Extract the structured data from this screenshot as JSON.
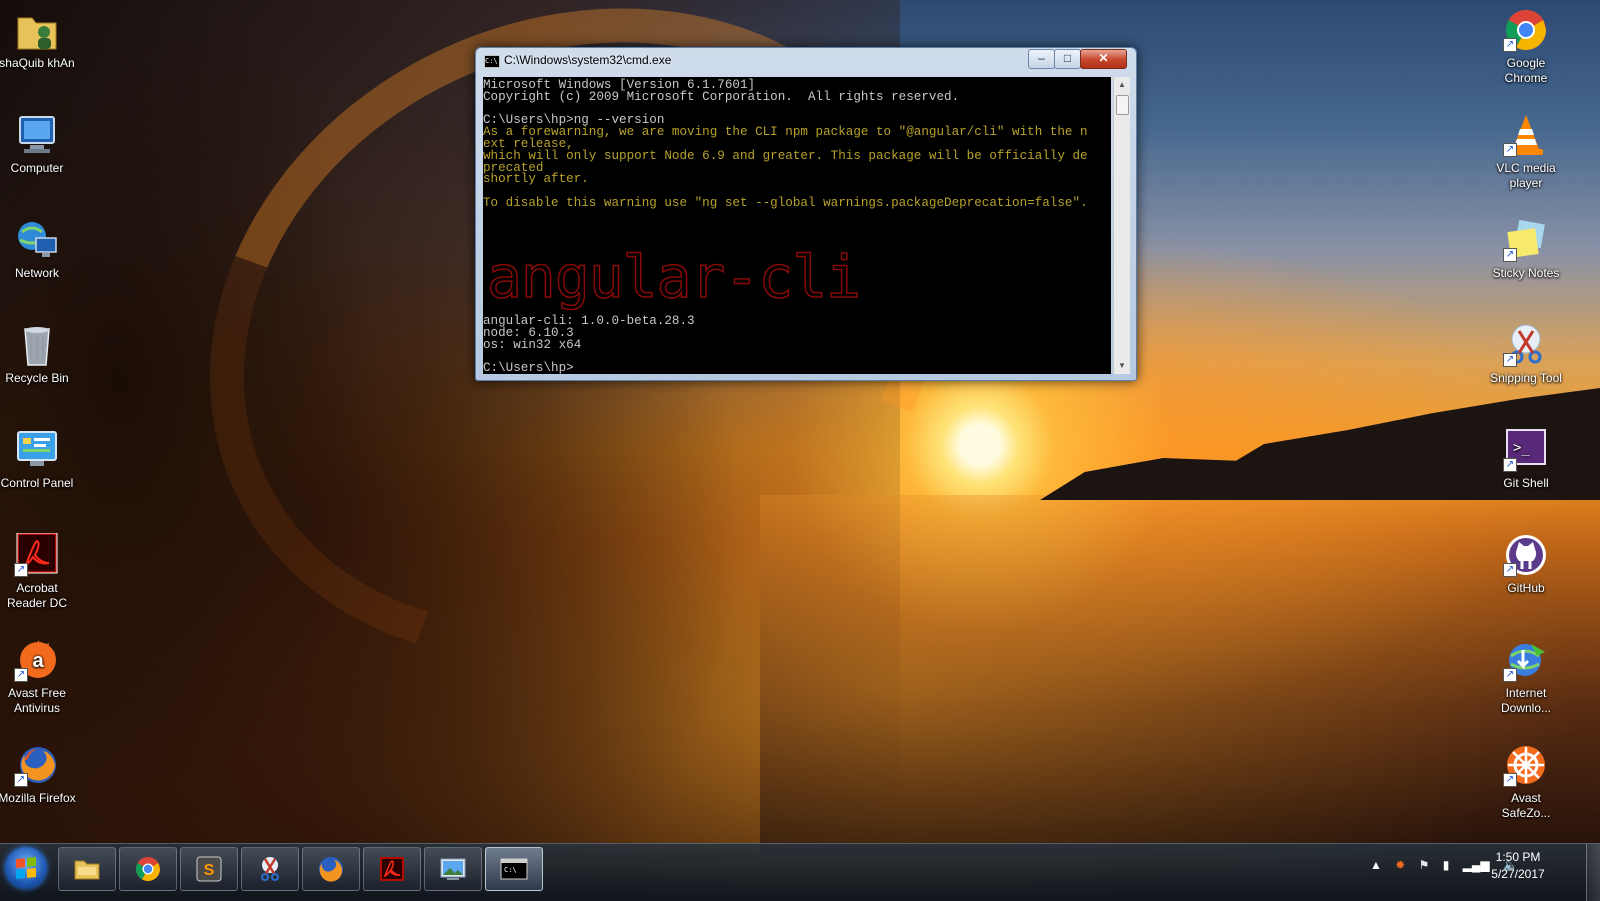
{
  "desktop": {
    "left_icons": [
      {
        "label": "shaQuib khAn",
        "icon": "user-folder-icon"
      },
      {
        "label": "Computer",
        "icon": "computer-icon"
      },
      {
        "label": "Network",
        "icon": "network-icon"
      },
      {
        "label": "Recycle Bin",
        "icon": "recycle-bin-icon"
      },
      {
        "label": "Control Panel",
        "icon": "control-panel-icon"
      },
      {
        "label": "Acrobat Reader DC",
        "icon": "acrobat-icon"
      },
      {
        "label": "Avast Free Antivirus",
        "icon": "avast-icon"
      },
      {
        "label": "Mozilla Firefox",
        "icon": "firefox-icon"
      }
    ],
    "right_icons": [
      {
        "label": "Google Chrome",
        "icon": "chrome-icon"
      },
      {
        "label": "VLC media player",
        "icon": "vlc-icon"
      },
      {
        "label": "Sticky Notes",
        "icon": "sticky-notes-icon"
      },
      {
        "label": "Snipping Tool",
        "icon": "snipping-tool-icon"
      },
      {
        "label": "Git Shell",
        "icon": "git-shell-icon"
      },
      {
        "label": "GitHub",
        "icon": "github-icon"
      },
      {
        "label": "Internet Downlo...",
        "icon": "internet-download-manager-icon"
      },
      {
        "label": "Avast SafeZo...",
        "icon": "avast-safezone-icon"
      }
    ]
  },
  "cmd": {
    "title": "C:\\Windows\\system32\\cmd.exe",
    "buttons": {
      "minimize": "–",
      "maximize": "□",
      "close": "✕"
    },
    "lines": [
      {
        "text": "Microsoft Windows [Version 6.1.7601]",
        "color": "white"
      },
      {
        "text": "Copyright (c) 2009 Microsoft Corporation.  All rights reserved.",
        "color": "white"
      },
      {
        "text": "",
        "color": "white"
      },
      {
        "text": "C:\\Users\\hp>ng --version",
        "color": "white"
      },
      {
        "text": "As a forewarning, we are moving the CLI npm package to \"@angular/cli\" with the n",
        "color": "yellow"
      },
      {
        "text": "ext release,",
        "color": "yellow"
      },
      {
        "text": "which will only support Node 6.9 and greater. This package will be officially de",
        "color": "yellow"
      },
      {
        "text": "precated",
        "color": "yellow"
      },
      {
        "text": "shortly after.",
        "color": "yellow"
      },
      {
        "text": "",
        "color": "yellow"
      },
      {
        "text": "To disable this warning use \"ng set --global warnings.packageDeprecation=false\".",
        "color": "yellow"
      }
    ],
    "ascii_banner": "angular-cli",
    "version_lines": [
      {
        "text": "angular-cli: 1.0.0-beta.28.3",
        "color": "white"
      },
      {
        "text": "node: 6.10.3",
        "color": "white"
      },
      {
        "text": "os: win32 x64",
        "color": "white"
      },
      {
        "text": "",
        "color": "white"
      },
      {
        "text": "C:\\Users\\hp>",
        "color": "white"
      }
    ]
  },
  "taskbar": {
    "pinned": [
      {
        "name": "file-explorer-icon"
      },
      {
        "name": "chrome-icon"
      },
      {
        "name": "sublime-text-icon"
      },
      {
        "name": "snipping-tool-icon"
      },
      {
        "name": "firefox-icon"
      },
      {
        "name": "acrobat-icon"
      },
      {
        "name": "photo-viewer-icon"
      },
      {
        "name": "cmd-icon",
        "active": true
      }
    ],
    "tray_icons": [
      "show-hidden-icons-icon",
      "avast-tray-icon",
      "action-center-icon",
      "power-icon",
      "network-signal-icon",
      "volume-icon"
    ],
    "time": "1:50 PM",
    "date": "5/27/2017"
  },
  "colors": {
    "console_bg": "#000000",
    "console_text": "#c8c8c8",
    "console_warning": "#b8a22a",
    "banner": "#8a0a0a"
  }
}
